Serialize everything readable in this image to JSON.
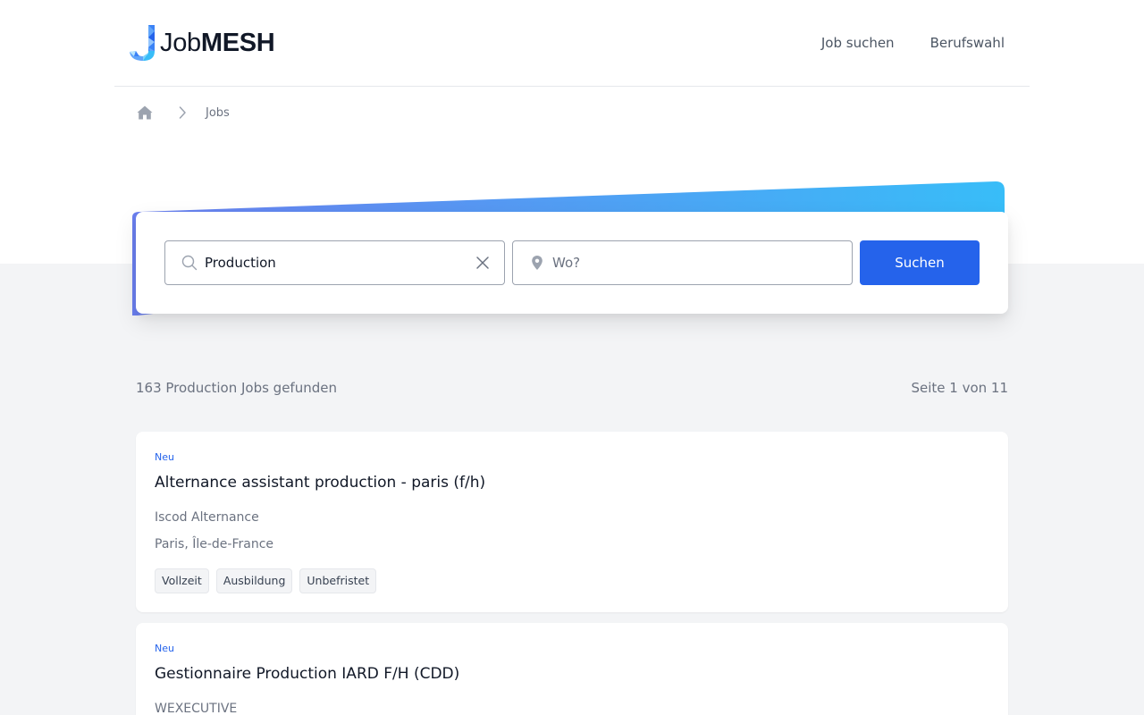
{
  "header": {
    "logo": {
      "part1": "Job",
      "part2": "MESH"
    },
    "nav": [
      "Job suchen",
      "Berufswahl"
    ]
  },
  "breadcrumb": {
    "current": "Jobs"
  },
  "search": {
    "what_value": "Production",
    "where_placeholder": "Wo?",
    "button_label": "Suchen"
  },
  "results": {
    "count_text": "163 Production Jobs gefunden",
    "page_text": "Seite 1 von 11"
  },
  "jobs": [
    {
      "badge": "Neu",
      "title": "Alternance assistant production - paris (f/h)",
      "company": "Iscod Alternance",
      "location": "Paris, Île-de-France",
      "tags": [
        "Vollzeit",
        "Ausbildung",
        "Unbefristet"
      ]
    },
    {
      "badge": "Neu",
      "title": "Gestionnaire Production IARD F/H (CDD)",
      "company": "WEXECUTIVE",
      "location": "",
      "tags": []
    }
  ],
  "colors": {
    "primary": "#2563eb",
    "gradient_start": "#6b7fef",
    "gradient_end": "#38bdf8",
    "page_bg": "#f3f4f6"
  },
  "icons": {
    "home": "home-icon",
    "chevron": "chevron-right-icon",
    "search": "search-icon",
    "clear": "close-icon",
    "location": "map-pin-icon"
  }
}
